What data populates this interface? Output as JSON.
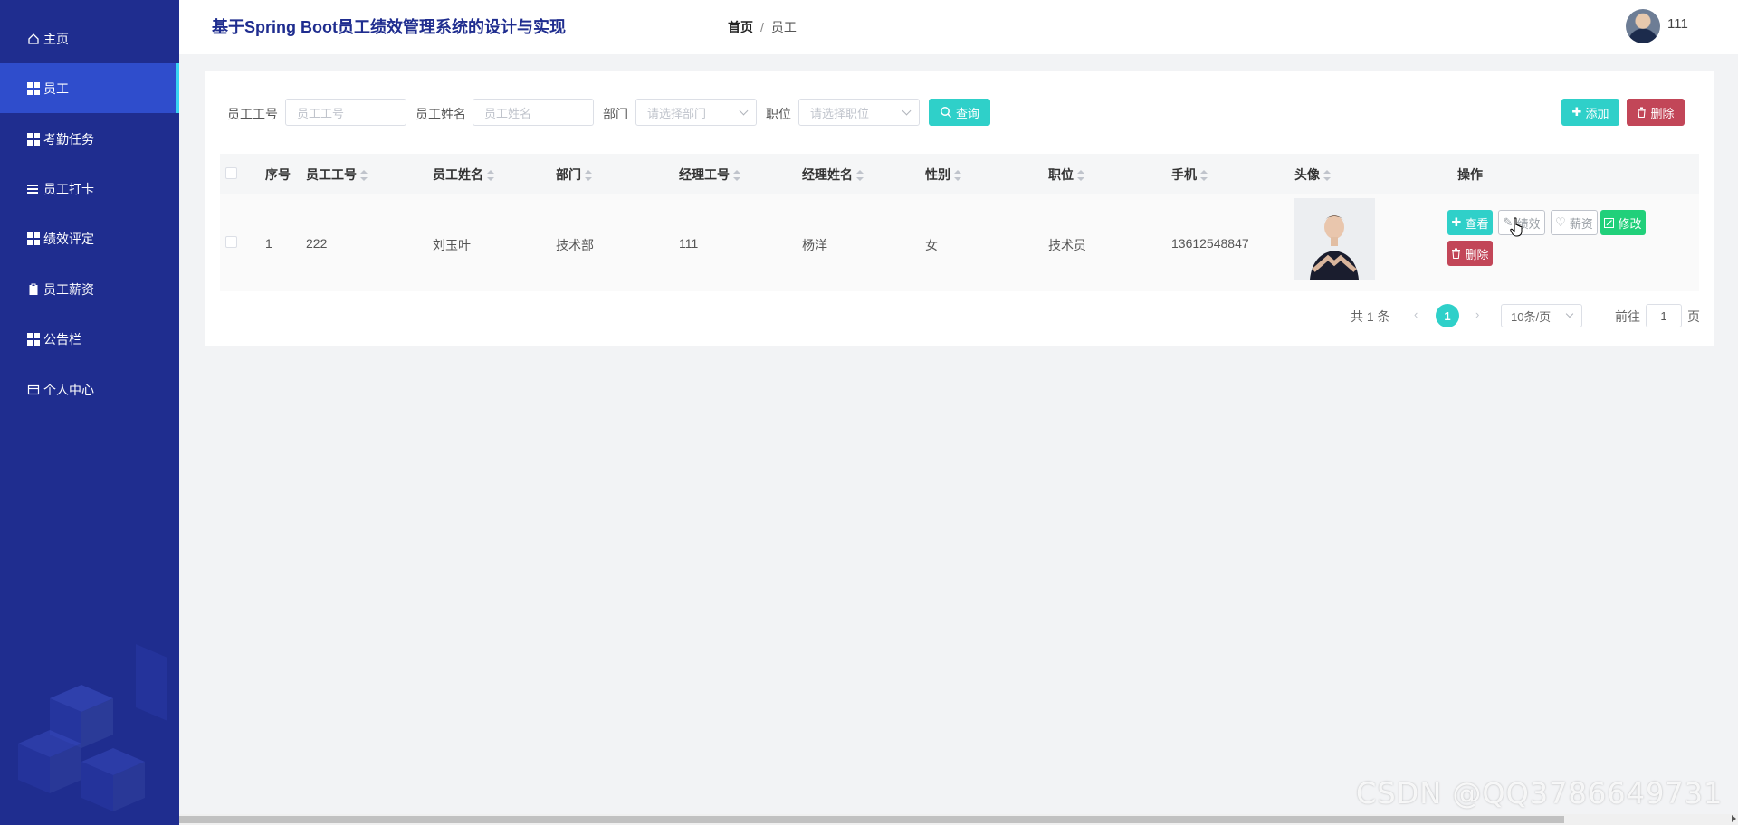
{
  "app": {
    "title": "基于Spring Boot员工绩效管理系统的设计与实现",
    "username": "111"
  },
  "breadcrumb": {
    "home": "首页",
    "separator": "/",
    "current": "员工"
  },
  "sidebar": {
    "items": [
      {
        "label": "主页",
        "icon": "home-icon"
      },
      {
        "label": "员工",
        "icon": "grid-icon",
        "active": true
      },
      {
        "label": "考勤任务",
        "icon": "grid-icon"
      },
      {
        "label": "员工打卡",
        "icon": "list-icon"
      },
      {
        "label": "绩效评定",
        "icon": "grid-icon"
      },
      {
        "label": "员工薪资",
        "icon": "clipboard-icon"
      },
      {
        "label": "公告栏",
        "icon": "grid-icon"
      },
      {
        "label": "个人中心",
        "icon": "card-icon"
      }
    ]
  },
  "search": {
    "emp_no_label": "员工工号",
    "emp_no_placeholder": "员工工号",
    "emp_name_label": "员工姓名",
    "emp_name_placeholder": "员工姓名",
    "dept_label": "部门",
    "dept_placeholder": "请选择部门",
    "position_label": "职位",
    "position_placeholder": "请选择职位",
    "query_label": "查询"
  },
  "toolbar": {
    "add_label": "添加",
    "delete_label": "删除"
  },
  "table": {
    "headers": [
      "序号",
      "员工工号",
      "员工姓名",
      "部门",
      "经理工号",
      "经理姓名",
      "性别",
      "职位",
      "手机",
      "头像",
      "操作"
    ],
    "rows": [
      {
        "index": "1",
        "emp_no": "222",
        "emp_name": "刘玉叶",
        "dept": "技术部",
        "manager_no": "111",
        "manager_name": "杨洋",
        "gender": "女",
        "position": "技术员",
        "phone": "13612548847",
        "actions": {
          "view": "查看",
          "performance": "绩效",
          "salary": "薪资",
          "edit": "修改",
          "delete": "删除"
        }
      }
    ]
  },
  "pagination": {
    "total": "共 1 条",
    "current_page": "1",
    "page_size": "10条/页",
    "goto_label": "前往",
    "goto_value": "1",
    "page_suffix": "页"
  },
  "watermark": "CSDN @QQ3786649731",
  "colors": {
    "sidebar_bg": "#1f2d8f",
    "sidebar_active": "#2f4dcc",
    "accent_teal": "#2fd0c9",
    "danger": "#c24658",
    "success": "#21d07a"
  }
}
